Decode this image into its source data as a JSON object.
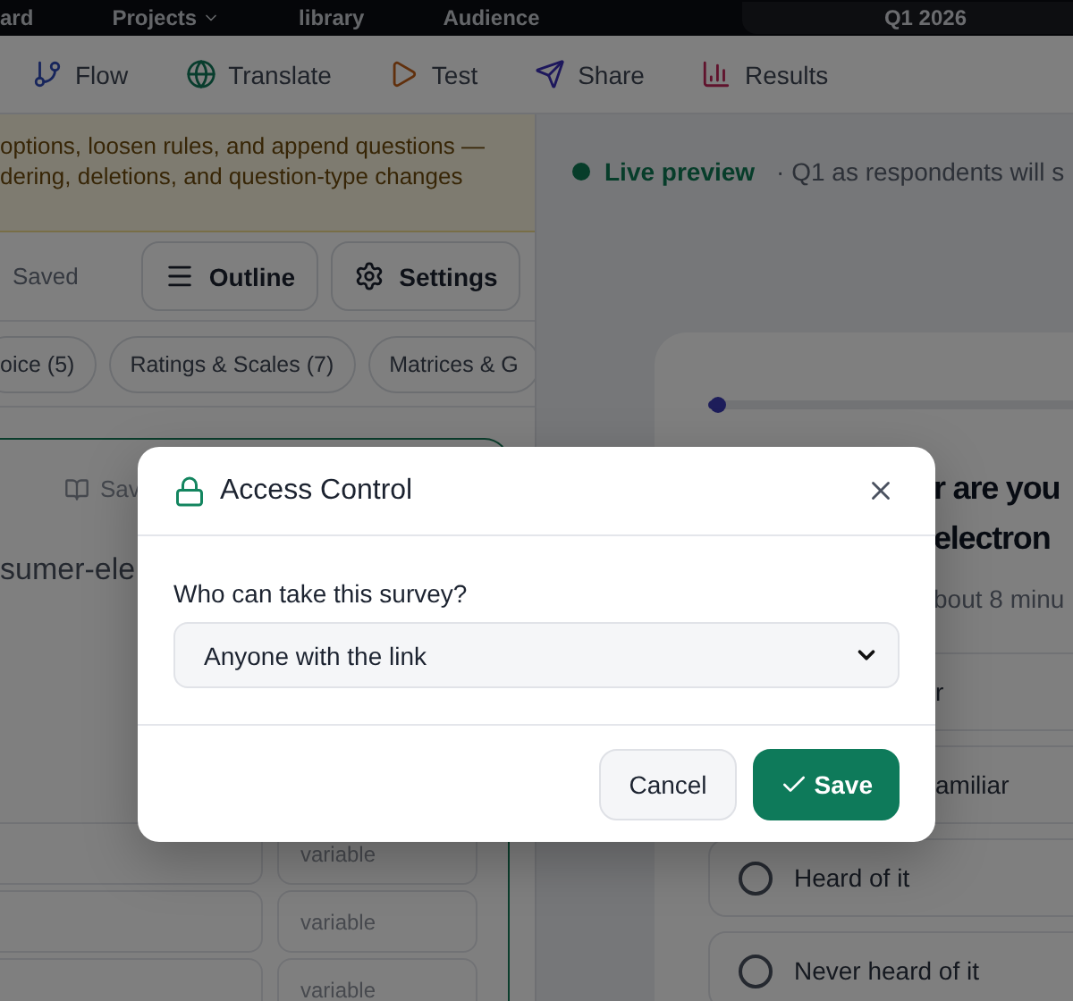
{
  "top_nav": {
    "items": [
      {
        "label": "ard",
        "dropdown": false
      },
      {
        "label": "Projects",
        "dropdown": true
      },
      {
        "label": "library",
        "dropdown": false
      },
      {
        "label": "Audience",
        "dropdown": false
      }
    ],
    "project": "Q1 2026"
  },
  "toolbar": {
    "tabs": [
      {
        "label": "Flow"
      },
      {
        "label": "Translate"
      },
      {
        "label": "Test"
      },
      {
        "label": "Share"
      },
      {
        "label": "Results"
      }
    ]
  },
  "editor": {
    "notice": [
      "options, loosen rules, and append questions —",
      "dering, deletions, and question-type changes"
    ],
    "save_status": "Saved",
    "buttons": [
      {
        "label": "Outline"
      },
      {
        "label": "Settings"
      }
    ],
    "categories": [
      {
        "label": "oice (5)"
      },
      {
        "label": "Ratings & Scales (7)"
      },
      {
        "label": "Matrices & G"
      }
    ],
    "library_button": "Sav",
    "name_text": "sumer-ele",
    "variable_placeholders": [
      "variable",
      "variable",
      "variable"
    ]
  },
  "preview": {
    "status": "Live preview",
    "caption": "· Q1 as respondents will s",
    "question": [
      "r are you",
      "electron"
    ],
    "subtitle": "bout 8 minu",
    "options": [
      {
        "label": "r",
        "covered": true,
        "selected": false
      },
      {
        "label": "amiliar",
        "covered": true,
        "selected": false
      },
      {
        "label": "Heard of it",
        "covered": false,
        "selected": false
      },
      {
        "label": "Never heard of it",
        "covered": false,
        "selected": false
      }
    ]
  },
  "dialog": {
    "title": "Access Control",
    "field_label": "Who can take this survey?",
    "value": "Anyone with the link",
    "buttons": [
      {
        "label": "Cancel",
        "kind": "secondary"
      },
      {
        "label": "Save",
        "kind": "primary"
      }
    ]
  }
}
